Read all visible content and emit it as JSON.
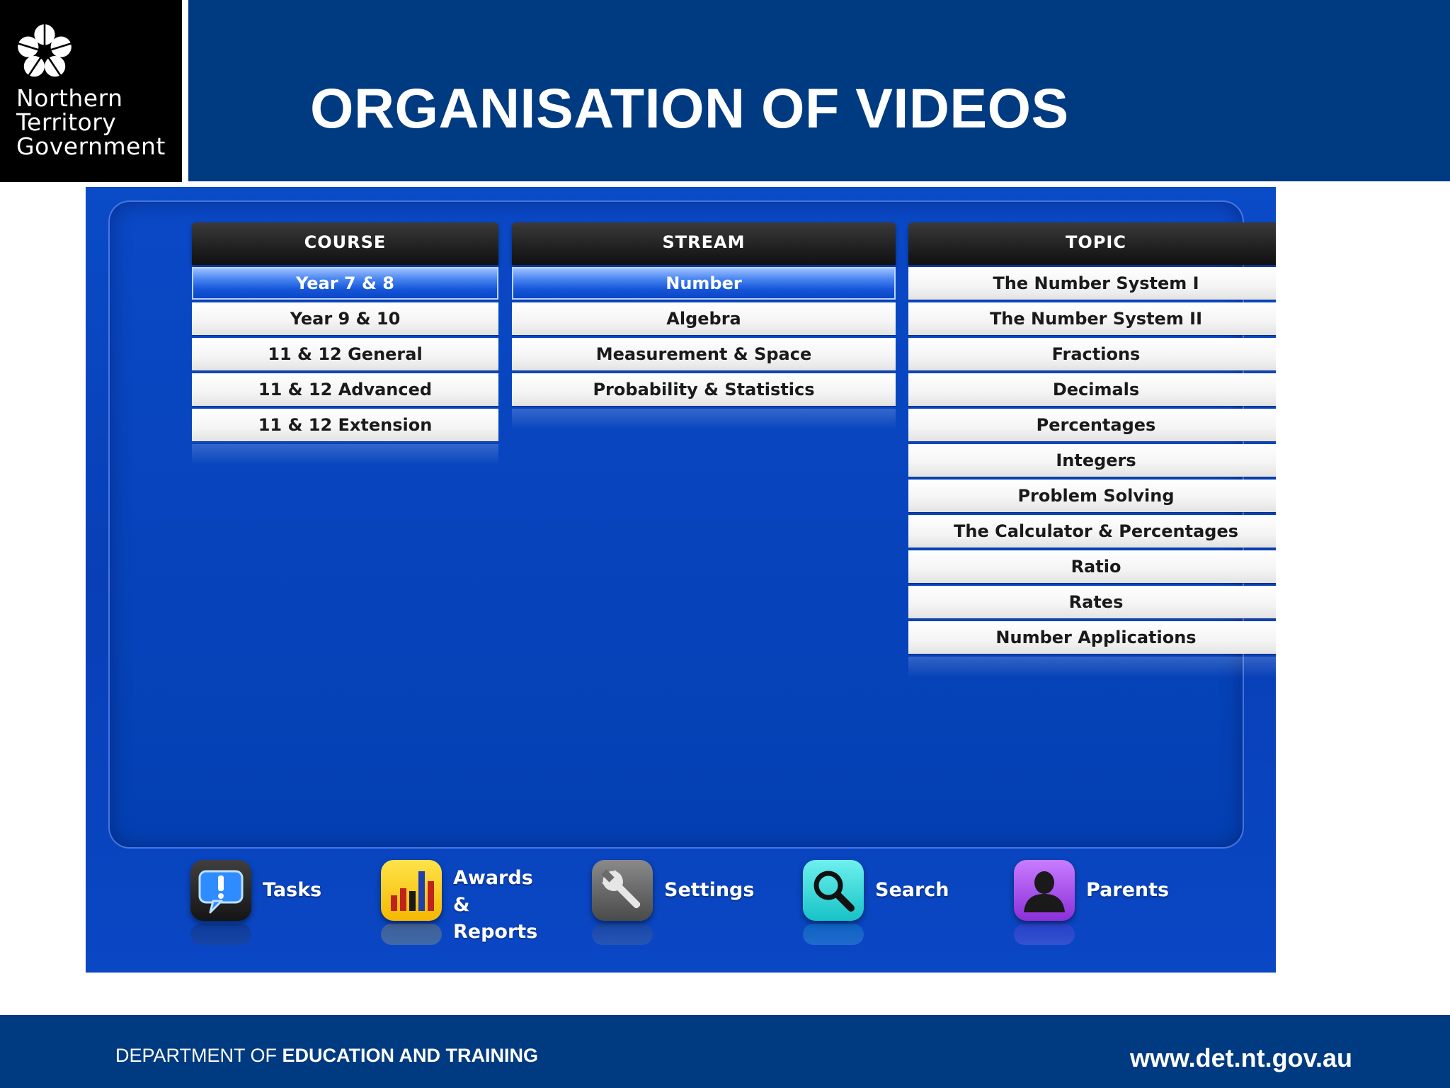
{
  "header": {
    "logo_text": "Northern\nTerritory\nGovernment",
    "title": "ORGANISATION OF VIDEOS"
  },
  "app": {
    "columns": {
      "course": {
        "header": "COURSE",
        "items": [
          "Year 7 & 8",
          "Year 9 & 10",
          "11 & 12 General",
          "11 & 12 Advanced",
          "11 & 12 Extension"
        ],
        "selected": "Year 7 & 8"
      },
      "stream": {
        "header": "STREAM",
        "items": [
          "Number",
          "Algebra",
          "Measurement & Space",
          "Probability & Statistics"
        ],
        "selected": "Number"
      },
      "topic": {
        "header": "TOPIC",
        "items": [
          "The Number System I",
          "The Number System II",
          "Fractions",
          "Decimals",
          "Percentages",
          "Integers",
          "Problem Solving",
          "The Calculator & Percentages",
          "Ratio",
          "Rates",
          "Number Applications"
        ]
      }
    },
    "toolbar": {
      "tasks": "Tasks",
      "awards": "Awards &\nReports",
      "settings": "Settings",
      "search": "Search",
      "parents": "Parents"
    }
  },
  "footer": {
    "dept_prefix": "DEPARTMENT OF ",
    "dept_bold": "EDUCATION AND TRAINING",
    "url": "www.det.nt.gov.au"
  },
  "colors": {
    "brand_navy": "#003a80",
    "app_blue": "#0a47c4",
    "selected_blue": "#1556d8"
  },
  "icons": {
    "logo": "flower-logo-icon",
    "tasks": "speech-bubble-exclamation-icon",
    "awards": "bar-chart-icon",
    "settings": "wrench-icon",
    "search": "magnifier-icon",
    "parents": "person-silhouette-icon"
  }
}
